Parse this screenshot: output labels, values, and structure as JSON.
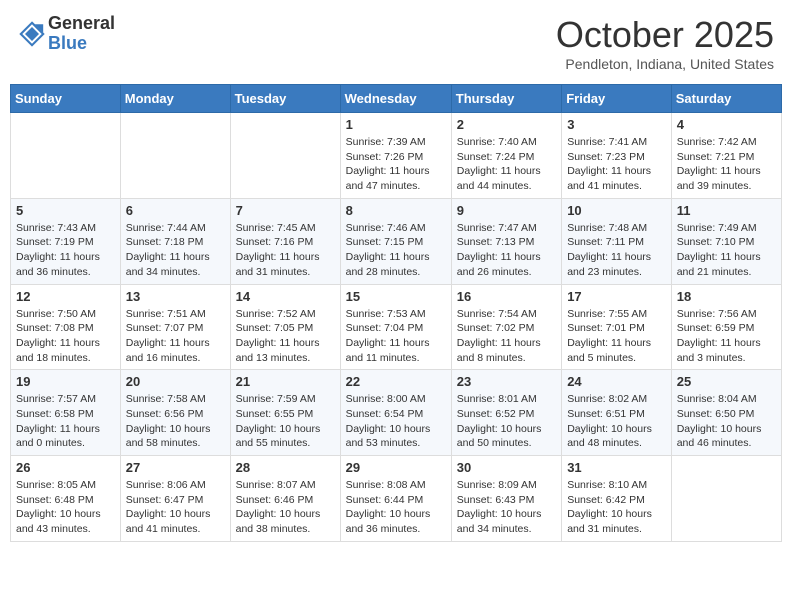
{
  "header": {
    "logo_general": "General",
    "logo_blue": "Blue",
    "month_title": "October 2025",
    "location": "Pendleton, Indiana, United States"
  },
  "weekdays": [
    "Sunday",
    "Monday",
    "Tuesday",
    "Wednesday",
    "Thursday",
    "Friday",
    "Saturday"
  ],
  "weeks": [
    [
      {
        "day": "",
        "content": ""
      },
      {
        "day": "",
        "content": ""
      },
      {
        "day": "",
        "content": ""
      },
      {
        "day": "1",
        "content": "Sunrise: 7:39 AM\nSunset: 7:26 PM\nDaylight: 11 hours and 47 minutes."
      },
      {
        "day": "2",
        "content": "Sunrise: 7:40 AM\nSunset: 7:24 PM\nDaylight: 11 hours and 44 minutes."
      },
      {
        "day": "3",
        "content": "Sunrise: 7:41 AM\nSunset: 7:23 PM\nDaylight: 11 hours and 41 minutes."
      },
      {
        "day": "4",
        "content": "Sunrise: 7:42 AM\nSunset: 7:21 PM\nDaylight: 11 hours and 39 minutes."
      }
    ],
    [
      {
        "day": "5",
        "content": "Sunrise: 7:43 AM\nSunset: 7:19 PM\nDaylight: 11 hours and 36 minutes."
      },
      {
        "day": "6",
        "content": "Sunrise: 7:44 AM\nSunset: 7:18 PM\nDaylight: 11 hours and 34 minutes."
      },
      {
        "day": "7",
        "content": "Sunrise: 7:45 AM\nSunset: 7:16 PM\nDaylight: 11 hours and 31 minutes."
      },
      {
        "day": "8",
        "content": "Sunrise: 7:46 AM\nSunset: 7:15 PM\nDaylight: 11 hours and 28 minutes."
      },
      {
        "day": "9",
        "content": "Sunrise: 7:47 AM\nSunset: 7:13 PM\nDaylight: 11 hours and 26 minutes."
      },
      {
        "day": "10",
        "content": "Sunrise: 7:48 AM\nSunset: 7:11 PM\nDaylight: 11 hours and 23 minutes."
      },
      {
        "day": "11",
        "content": "Sunrise: 7:49 AM\nSunset: 7:10 PM\nDaylight: 11 hours and 21 minutes."
      }
    ],
    [
      {
        "day": "12",
        "content": "Sunrise: 7:50 AM\nSunset: 7:08 PM\nDaylight: 11 hours and 18 minutes."
      },
      {
        "day": "13",
        "content": "Sunrise: 7:51 AM\nSunset: 7:07 PM\nDaylight: 11 hours and 16 minutes."
      },
      {
        "day": "14",
        "content": "Sunrise: 7:52 AM\nSunset: 7:05 PM\nDaylight: 11 hours and 13 minutes."
      },
      {
        "day": "15",
        "content": "Sunrise: 7:53 AM\nSunset: 7:04 PM\nDaylight: 11 hours and 11 minutes."
      },
      {
        "day": "16",
        "content": "Sunrise: 7:54 AM\nSunset: 7:02 PM\nDaylight: 11 hours and 8 minutes."
      },
      {
        "day": "17",
        "content": "Sunrise: 7:55 AM\nSunset: 7:01 PM\nDaylight: 11 hours and 5 minutes."
      },
      {
        "day": "18",
        "content": "Sunrise: 7:56 AM\nSunset: 6:59 PM\nDaylight: 11 hours and 3 minutes."
      }
    ],
    [
      {
        "day": "19",
        "content": "Sunrise: 7:57 AM\nSunset: 6:58 PM\nDaylight: 11 hours and 0 minutes."
      },
      {
        "day": "20",
        "content": "Sunrise: 7:58 AM\nSunset: 6:56 PM\nDaylight: 10 hours and 58 minutes."
      },
      {
        "day": "21",
        "content": "Sunrise: 7:59 AM\nSunset: 6:55 PM\nDaylight: 10 hours and 55 minutes."
      },
      {
        "day": "22",
        "content": "Sunrise: 8:00 AM\nSunset: 6:54 PM\nDaylight: 10 hours and 53 minutes."
      },
      {
        "day": "23",
        "content": "Sunrise: 8:01 AM\nSunset: 6:52 PM\nDaylight: 10 hours and 50 minutes."
      },
      {
        "day": "24",
        "content": "Sunrise: 8:02 AM\nSunset: 6:51 PM\nDaylight: 10 hours and 48 minutes."
      },
      {
        "day": "25",
        "content": "Sunrise: 8:04 AM\nSunset: 6:50 PM\nDaylight: 10 hours and 46 minutes."
      }
    ],
    [
      {
        "day": "26",
        "content": "Sunrise: 8:05 AM\nSunset: 6:48 PM\nDaylight: 10 hours and 43 minutes."
      },
      {
        "day": "27",
        "content": "Sunrise: 8:06 AM\nSunset: 6:47 PM\nDaylight: 10 hours and 41 minutes."
      },
      {
        "day": "28",
        "content": "Sunrise: 8:07 AM\nSunset: 6:46 PM\nDaylight: 10 hours and 38 minutes."
      },
      {
        "day": "29",
        "content": "Sunrise: 8:08 AM\nSunset: 6:44 PM\nDaylight: 10 hours and 36 minutes."
      },
      {
        "day": "30",
        "content": "Sunrise: 8:09 AM\nSunset: 6:43 PM\nDaylight: 10 hours and 34 minutes."
      },
      {
        "day": "31",
        "content": "Sunrise: 8:10 AM\nSunset: 6:42 PM\nDaylight: 10 hours and 31 minutes."
      },
      {
        "day": "",
        "content": ""
      }
    ]
  ]
}
